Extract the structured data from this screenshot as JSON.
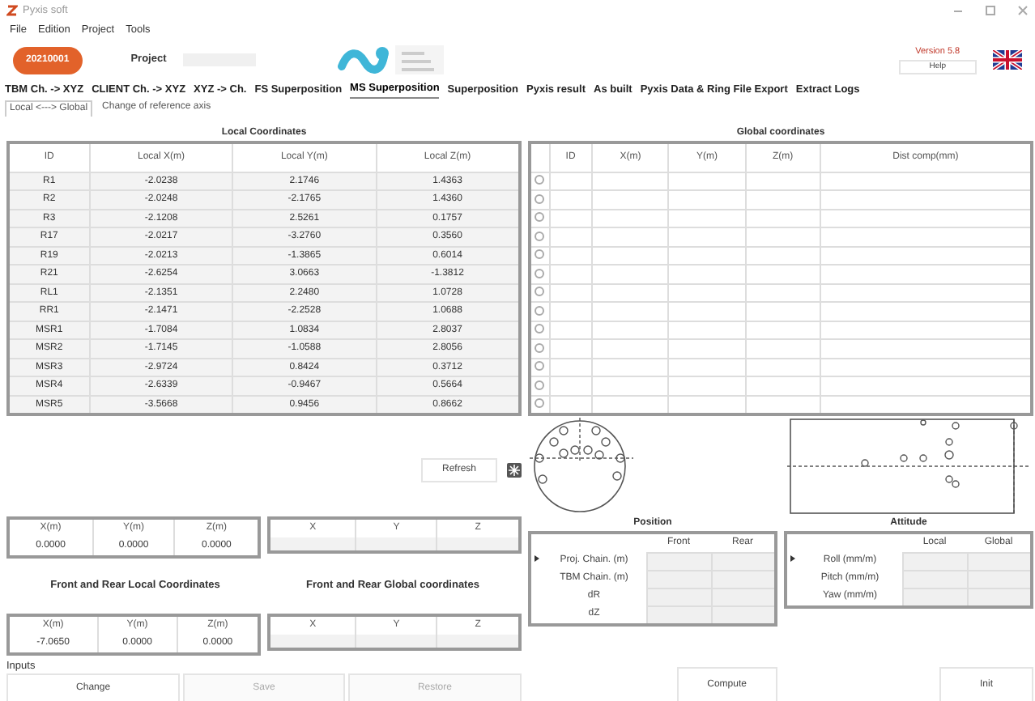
{
  "window": {
    "title": "Pyxis soft"
  },
  "menu": [
    "File",
    "Edition",
    "Project",
    "Tools"
  ],
  "header": {
    "badge": "20210001",
    "project_label": "Project",
    "version": "Version 5.8",
    "help_button": "Help"
  },
  "tabs": [
    {
      "label": "TBM Ch. -> XYZ",
      "selected": false
    },
    {
      "label": "CLIENT Ch. -> XYZ",
      "selected": false
    },
    {
      "label": "XYZ -> Ch.",
      "selected": false
    },
    {
      "label": "FS Superposition",
      "selected": false
    },
    {
      "label": "MS Superposition",
      "selected": true
    },
    {
      "label": "Superposition",
      "selected": false
    },
    {
      "label": "Pyxis result",
      "selected": false
    },
    {
      "label": "As built",
      "selected": false
    },
    {
      "label": "Pyxis Data & Ring File Export",
      "selected": false
    },
    {
      "label": "Extract Logs",
      "selected": false
    }
  ],
  "subtabs": [
    {
      "label": "Local <---> Global",
      "selected": true
    },
    {
      "label": "Change of reference axis",
      "selected": false
    }
  ],
  "local_coordinates": {
    "title": "Local Coordinates",
    "columns": [
      "ID",
      "Local X(m)",
      "Local Y(m)",
      "Local Z(m)"
    ],
    "rows": [
      [
        "R1",
        "-2.0238",
        "2.1746",
        "1.4363"
      ],
      [
        "R2",
        "-2.0248",
        "-2.1765",
        "1.4360"
      ],
      [
        "R3",
        "-2.1208",
        "2.5261",
        "0.1757"
      ],
      [
        "R17",
        "-2.0217",
        "-3.2760",
        "0.3560"
      ],
      [
        "R19",
        "-2.0213",
        "-1.3865",
        "0.6014"
      ],
      [
        "R21",
        "-2.6254",
        "3.0663",
        "-1.3812"
      ],
      [
        "RL1",
        "-2.1351",
        "2.2480",
        "1.0728"
      ],
      [
        "RR1",
        "-2.1471",
        "-2.2528",
        "1.0688"
      ],
      [
        "MSR1",
        "-1.7084",
        "1.0834",
        "2.8037"
      ],
      [
        "MSR2",
        "-1.7145",
        "-1.0588",
        "2.8056"
      ],
      [
        "MSR3",
        "-2.9724",
        "0.8424",
        "0.3712"
      ],
      [
        "MSR4",
        "-2.6339",
        "-0.9467",
        "0.5664"
      ],
      [
        "MSR5",
        "-3.5668",
        "0.9456",
        "0.8662"
      ]
    ]
  },
  "global_coordinates": {
    "title": "Global coordinates",
    "columns": [
      "ID",
      "X(m)",
      "Y(m)",
      "Z(m)",
      "Dist comp(mm)"
    ],
    "rows": [
      {
        "selected": false
      },
      {
        "selected": false
      },
      {
        "selected": false
      },
      {
        "selected": false
      },
      {
        "selected": false
      },
      {
        "selected": false
      },
      {
        "selected": false
      },
      {
        "selected": false
      },
      {
        "selected": false
      },
      {
        "selected": false
      },
      {
        "selected": false
      },
      {
        "selected": false
      },
      {
        "selected": false
      }
    ]
  },
  "refresh_button": "Refresh",
  "origin": {
    "local": {
      "columns": [
        "X(m)",
        "Y(m)",
        "Z(m)"
      ],
      "values": [
        "0.0000",
        "0.0000",
        "0.0000"
      ]
    },
    "global": {
      "columns": [
        "X",
        "Y",
        "Z"
      ]
    }
  },
  "front_rear": {
    "local_title": "Front and Rear Local Coordinates",
    "global_title": "Front and Rear Global coordinates",
    "local": {
      "columns": [
        "X(m)",
        "Y(m)",
        "Z(m)"
      ],
      "values": [
        "-7.0650",
        "0.0000",
        "0.0000"
      ]
    },
    "global": {
      "columns": [
        "X",
        "Y",
        "Z"
      ]
    }
  },
  "inputs": {
    "label": "Inputs",
    "buttons": [
      {
        "label": "Change",
        "disabled": false
      },
      {
        "label": "Save",
        "disabled": true
      },
      {
        "label": "Restore",
        "disabled": true
      }
    ]
  },
  "position": {
    "title": "Position",
    "columns": [
      "Front",
      "Rear"
    ],
    "rows": [
      {
        "label": "Proj. Chain. (m)",
        "current": true
      },
      {
        "label": "TBM Chain. (m)",
        "current": false
      },
      {
        "label": "dR",
        "current": false
      },
      {
        "label": "dZ",
        "current": false
      }
    ]
  },
  "attitude": {
    "title": "Attitude",
    "columns": [
      "Local",
      "Global"
    ],
    "rows": [
      {
        "label": "Roll (mm/m)",
        "current": true
      },
      {
        "label": "Pitch (mm/m)",
        "current": false
      },
      {
        "label": "Yaw (mm/m)",
        "current": false
      }
    ]
  },
  "compute_button": "Compute",
  "init_button": "Init"
}
